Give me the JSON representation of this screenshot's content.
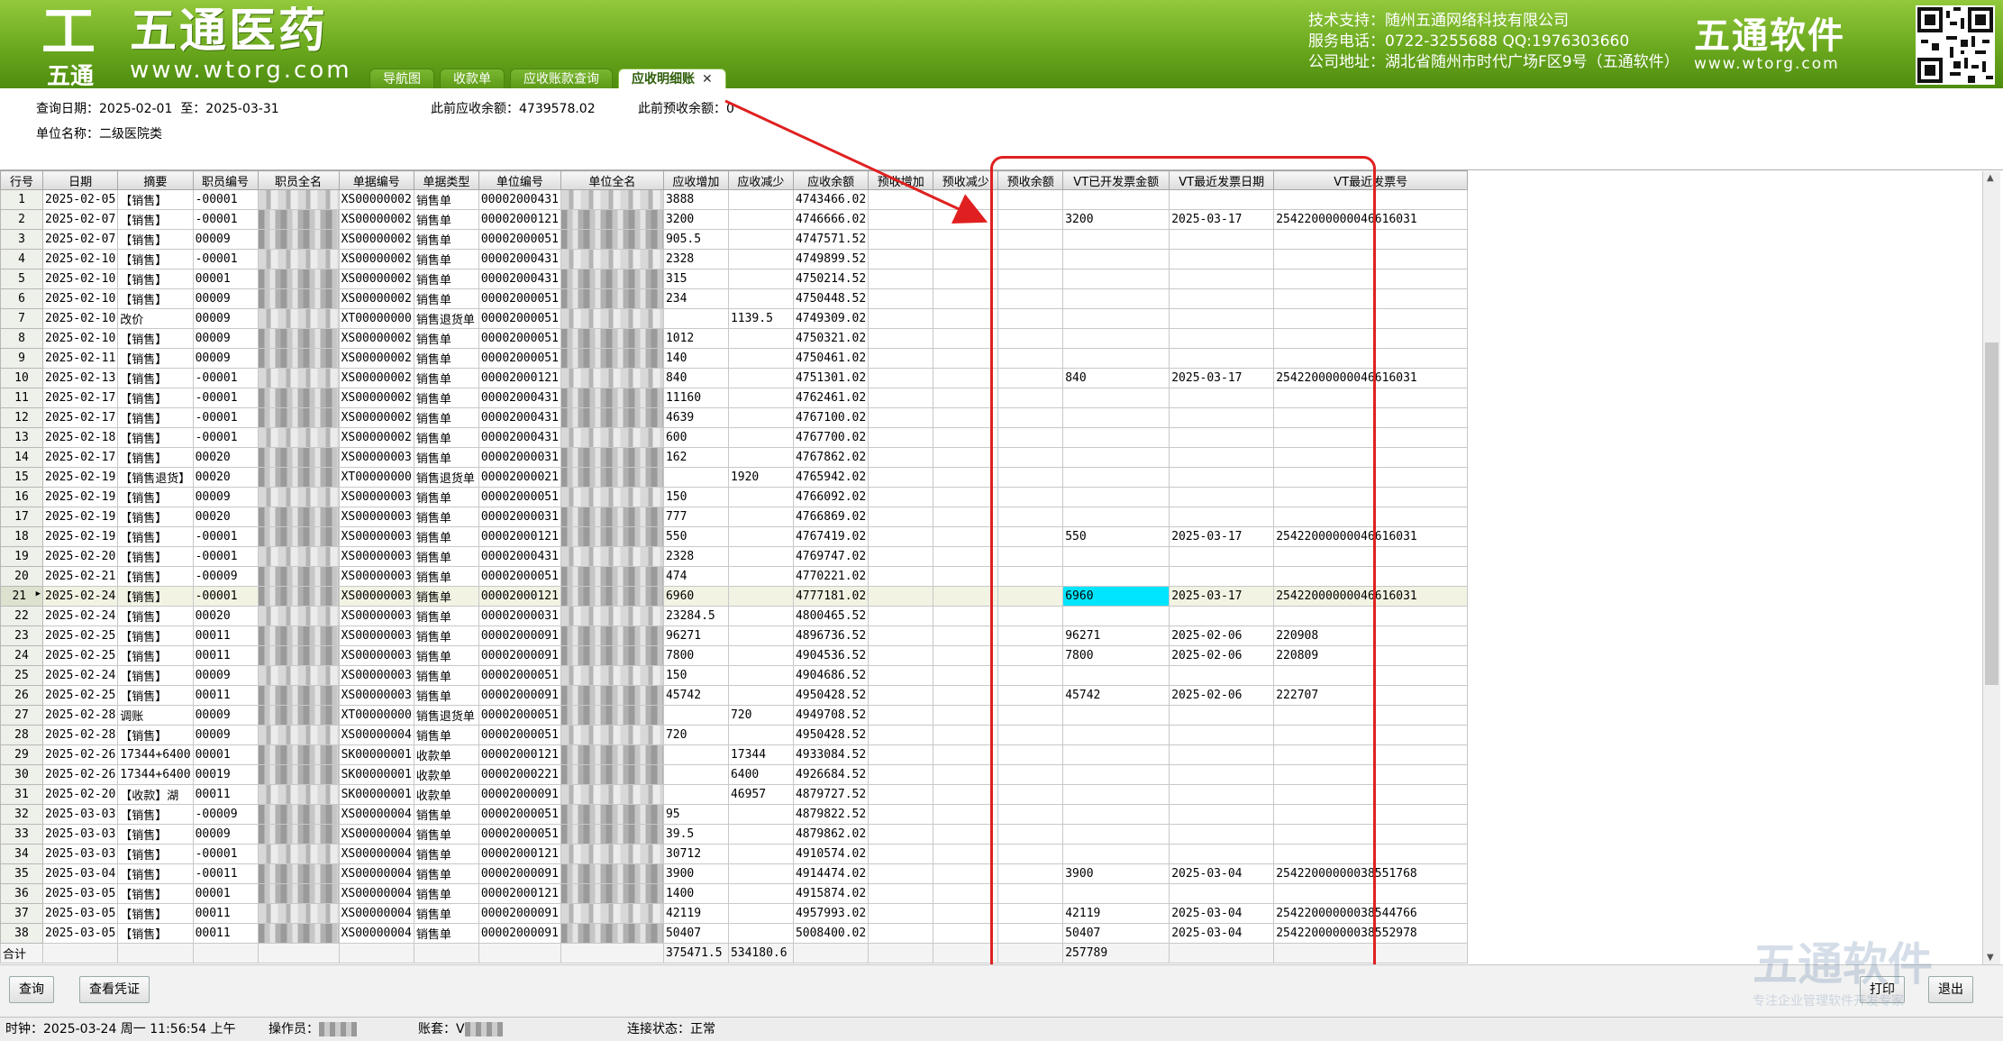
{
  "header": {
    "logo_cn": "五通医药",
    "logo_url": "www.wtorg.com",
    "logo_sub": "五通",
    "support_lines": [
      "技术支持：随州五通网络科技有限公司",
      "服务电话：0722-3255688  QQ:1976303660",
      "公司地址：湖北省随州市时代广场F区9号（五通软件）"
    ],
    "brand_cn": "五通软件",
    "brand_url": "www.wtorg.com",
    "tabs": [
      {
        "label": "导航图",
        "active": false
      },
      {
        "label": "收款单",
        "active": false
      },
      {
        "label": "应收账款查询",
        "active": false
      },
      {
        "label": "应收明细账",
        "active": true
      }
    ],
    "close_glyph": "✕"
  },
  "info": {
    "query_date_label": "查询日期：",
    "date_from": "2025-02-01",
    "date_to_label": "至：",
    "date_to": "2025-03-31",
    "prev_receivable_label": "此前应收余额：",
    "prev_receivable": "4739578.02",
    "prev_prepaid_label": "此前预收余额：",
    "prev_prepaid": "0",
    "unit_name_label": "单位名称：",
    "unit_name": "二级医院类"
  },
  "table": {
    "columns": [
      "行号",
      "日期",
      "摘要",
      "职员编号",
      "职员全名",
      "单据编号",
      "单据类型",
      "单位编号",
      "单位全名",
      "应收增加",
      "应收减少",
      "应收余额",
      "预收增加",
      "预收减少",
      "预收余额",
      "VT已开发票金额",
      "VT最近发票日期",
      "VT最近发票号"
    ],
    "rows": [
      [
        "1",
        "2025-02-05",
        "【销售】",
        "-00001",
        "",
        "XS00000002",
        "销售单",
        "00002000431",
        "",
        "3888",
        "",
        "4743466.02",
        "",
        "",
        "",
        "",
        "",
        ""
      ],
      [
        "2",
        "2025-02-07",
        "【销售】",
        "-00001",
        "",
        "XS00000002",
        "销售单",
        "00002000121",
        "",
        "3200",
        "",
        "4746666.02",
        "",
        "",
        "",
        "3200",
        "2025-03-17",
        "25422000000046616031"
      ],
      [
        "3",
        "2025-02-07",
        "【销售】",
        "00009",
        "",
        "XS00000002",
        "销售单",
        "00002000051",
        "",
        "905.5",
        "",
        "4747571.52",
        "",
        "",
        "",
        "",
        "",
        ""
      ],
      [
        "4",
        "2025-02-10",
        "【销售】",
        "-00001",
        "",
        "XS00000002",
        "销售单",
        "00002000431",
        "",
        "2328",
        "",
        "4749899.52",
        "",
        "",
        "",
        "",
        "",
        ""
      ],
      [
        "5",
        "2025-02-10",
        "【销售】",
        "00001",
        "",
        "XS00000002",
        "销售单",
        "00002000431",
        "",
        "315",
        "",
        "4750214.52",
        "",
        "",
        "",
        "",
        "",
        ""
      ],
      [
        "6",
        "2025-02-10",
        "【销售】",
        "00009",
        "",
        "XS00000002",
        "销售单",
        "00002000051",
        "",
        "234",
        "",
        "4750448.52",
        "",
        "",
        "",
        "",
        "",
        ""
      ],
      [
        "7",
        "2025-02-10",
        "改价",
        "00009",
        "",
        "XT00000000",
        "销售退货单",
        "00002000051",
        "",
        "",
        "1139.5",
        "4749309.02",
        "",
        "",
        "",
        "",
        "",
        ""
      ],
      [
        "8",
        "2025-02-10",
        "【销售】",
        "00009",
        "",
        "XS00000002",
        "销售单",
        "00002000051",
        "",
        "1012",
        "",
        "4750321.02",
        "",
        "",
        "",
        "",
        "",
        ""
      ],
      [
        "9",
        "2025-02-11",
        "【销售】",
        "00009",
        "",
        "XS00000002",
        "销售单",
        "00002000051",
        "",
        "140",
        "",
        "4750461.02",
        "",
        "",
        "",
        "",
        "",
        ""
      ],
      [
        "10",
        "2025-02-13",
        "【销售】",
        "-00001",
        "",
        "XS00000002",
        "销售单",
        "00002000121",
        "",
        "840",
        "",
        "4751301.02",
        "",
        "",
        "",
        "840",
        "2025-03-17",
        "25422000000046616031"
      ],
      [
        "11",
        "2025-02-17",
        "【销售】",
        "-00001",
        "",
        "XS00000002",
        "销售单",
        "00002000431",
        "",
        "11160",
        "",
        "4762461.02",
        "",
        "",
        "",
        "",
        "",
        ""
      ],
      [
        "12",
        "2025-02-17",
        "【销售】",
        "-00001",
        "",
        "XS00000002",
        "销售单",
        "00002000431",
        "",
        "4639",
        "",
        "4767100.02",
        "",
        "",
        "",
        "",
        "",
        ""
      ],
      [
        "13",
        "2025-02-18",
        "【销售】",
        "-00001",
        "",
        "XS00000002",
        "销售单",
        "00002000431",
        "",
        "600",
        "",
        "4767700.02",
        "",
        "",
        "",
        "",
        "",
        ""
      ],
      [
        "14",
        "2025-02-17",
        "【销售】",
        "00020",
        "",
        "XS00000003",
        "销售单",
        "00002000031",
        "",
        "162",
        "",
        "4767862.02",
        "",
        "",
        "",
        "",
        "",
        ""
      ],
      [
        "15",
        "2025-02-19",
        "【销售退货】",
        "00020",
        "",
        "XT00000000",
        "销售退货单",
        "00002000021",
        "",
        "",
        "1920",
        "4765942.02",
        "",
        "",
        "",
        "",
        "",
        ""
      ],
      [
        "16",
        "2025-02-19",
        "【销售】",
        "00009",
        "",
        "XS00000003",
        "销售单",
        "00002000051",
        "",
        "150",
        "",
        "4766092.02",
        "",
        "",
        "",
        "",
        "",
        ""
      ],
      [
        "17",
        "2025-02-19",
        "【销售】",
        "00020",
        "",
        "XS00000003",
        "销售单",
        "00002000031",
        "",
        "777",
        "",
        "4766869.02",
        "",
        "",
        "",
        "",
        "",
        ""
      ],
      [
        "18",
        "2025-02-19",
        "【销售】",
        "-00001",
        "",
        "XS00000003",
        "销售单",
        "00002000121",
        "",
        "550",
        "",
        "4767419.02",
        "",
        "",
        "",
        "550",
        "2025-03-17",
        "25422000000046616031"
      ],
      [
        "19",
        "2025-02-20",
        "【销售】",
        "-00001",
        "",
        "XS00000003",
        "销售单",
        "00002000431",
        "",
        "2328",
        "",
        "4769747.02",
        "",
        "",
        "",
        "",
        "",
        ""
      ],
      [
        "20",
        "2025-02-21",
        "【销售】",
        "-00009",
        "",
        "XS00000003",
        "销售单",
        "00002000051",
        "",
        "474",
        "",
        "4770221.02",
        "",
        "",
        "",
        "",
        "",
        ""
      ],
      [
        "21",
        "2025-02-24",
        "【销售】",
        "-00001",
        "",
        "XS00000003",
        "销售单",
        "00002000121",
        "",
        "6960",
        "",
        "4777181.02",
        "",
        "",
        "",
        "6960",
        "2025-03-17",
        "25422000000046616031"
      ],
      [
        "22",
        "2025-02-24",
        "【销售】",
        "00020",
        "",
        "XS00000003",
        "销售单",
        "00002000031",
        "",
        "23284.5",
        "",
        "4800465.52",
        "",
        "",
        "",
        "",
        "",
        ""
      ],
      [
        "23",
        "2025-02-25",
        "【销售】",
        "00011",
        "",
        "XS00000003",
        "销售单",
        "00002000091",
        "",
        "96271",
        "",
        "4896736.52",
        "",
        "",
        "",
        "96271",
        "2025-02-06",
        "220908"
      ],
      [
        "24",
        "2025-02-25",
        "【销售】",
        "00011",
        "",
        "XS00000003",
        "销售单",
        "00002000091",
        "",
        "7800",
        "",
        "4904536.52",
        "",
        "",
        "",
        "7800",
        "2025-02-06",
        "220809"
      ],
      [
        "25",
        "2025-02-24",
        "【销售】",
        "00009",
        "",
        "XS00000003",
        "销售单",
        "00002000051",
        "",
        "150",
        "",
        "4904686.52",
        "",
        "",
        "",
        "",
        "",
        ""
      ],
      [
        "26",
        "2025-02-25",
        "【销售】",
        "00011",
        "",
        "XS00000003",
        "销售单",
        "00002000091",
        "",
        "45742",
        "",
        "4950428.52",
        "",
        "",
        "",
        "45742",
        "2025-02-06",
        "222707"
      ],
      [
        "27",
        "2025-02-28",
        "调账",
        "00009",
        "",
        "XT00000000",
        "销售退货单",
        "00002000051",
        "",
        "",
        "720",
        "4949708.52",
        "",
        "",
        "",
        "",
        "",
        ""
      ],
      [
        "28",
        "2025-02-28",
        "【销售】",
        "00009",
        "",
        "XS00000004",
        "销售单",
        "00002000051",
        "",
        "720",
        "",
        "4950428.52",
        "",
        "",
        "",
        "",
        "",
        ""
      ],
      [
        "29",
        "2025-02-26",
        "17344+6400",
        "00001",
        "",
        "SK00000001",
        "收款单",
        "00002000121",
        "",
        "",
        "17344",
        "4933084.52",
        "",
        "",
        "",
        "",
        "",
        ""
      ],
      [
        "30",
        "2025-02-26",
        "17344+6400",
        "00019",
        "",
        "SK00000001",
        "收款单",
        "00002000221",
        "",
        "",
        "6400",
        "4926684.52",
        "",
        "",
        "",
        "",
        "",
        ""
      ],
      [
        "31",
        "2025-02-20",
        "【收款】湖",
        "00011",
        "",
        "SK00000001",
        "收款单",
        "00002000091",
        "",
        "",
        "46957",
        "4879727.52",
        "",
        "",
        "",
        "",
        "",
        ""
      ],
      [
        "32",
        "2025-03-03",
        "【销售】",
        "-00009",
        "",
        "XS00000004",
        "销售单",
        "00002000051",
        "",
        "95",
        "",
        "4879822.52",
        "",
        "",
        "",
        "",
        "",
        ""
      ],
      [
        "33",
        "2025-03-03",
        "【销售】",
        "00009",
        "",
        "XS00000004",
        "销售单",
        "00002000051",
        "",
        "39.5",
        "",
        "4879862.02",
        "",
        "",
        "",
        "",
        "",
        ""
      ],
      [
        "34",
        "2025-03-03",
        "【销售】",
        "-00001",
        "",
        "XS00000004",
        "销售单",
        "00002000121",
        "",
        "30712",
        "",
        "4910574.02",
        "",
        "",
        "",
        "",
        "",
        ""
      ],
      [
        "35",
        "2025-03-04",
        "【销售】",
        "-00011",
        "",
        "XS00000004",
        "销售单",
        "00002000091",
        "",
        "3900",
        "",
        "4914474.02",
        "",
        "",
        "",
        "3900",
        "2025-03-04",
        "25422000000038551768"
      ],
      [
        "36",
        "2025-03-05",
        "【销售】",
        "00001",
        "",
        "XS00000004",
        "销售单",
        "00002000121",
        "",
        "1400",
        "",
        "4915874.02",
        "",
        "",
        "",
        "",
        "",
        ""
      ],
      [
        "37",
        "2025-03-05",
        "【销售】",
        "00011",
        "",
        "XS00000004",
        "销售单",
        "00002000091",
        "",
        "42119",
        "",
        "4957993.02",
        "",
        "",
        "",
        "42119",
        "2025-03-04",
        "25422000000038544766"
      ],
      [
        "38",
        "2025-03-05",
        "【销售】",
        "00011",
        "",
        "XS00000004",
        "销售单",
        "00002000091",
        "",
        "50407",
        "",
        "5008400.02",
        "",
        "",
        "",
        "50407",
        "2025-03-04",
        "25422000000038552978"
      ]
    ],
    "selected_row": 21,
    "highlight_cell": {
      "row": 21,
      "col": 15
    },
    "total_row": {
      "label": "合计",
      "recv_increase": "375471.5",
      "recv_decrease": "534180.6",
      "invoice_amount": "257789"
    },
    "row_marker": "▶"
  },
  "buttons": {
    "query": "查询",
    "view_voucher": "查看凭证",
    "print": "打印",
    "exit": "退出"
  },
  "watermark": {
    "cn": "五通软件",
    "sub": "专注企业管理软件开发专家"
  },
  "status": {
    "time_label": "时钟：",
    "time": "2025-03-24 周一 11:56:54 上午",
    "operator_label": "操作员：",
    "account_label": "账套：",
    "account_prefix": "V",
    "connection": "连接状态：正常"
  },
  "colors": {
    "banner_green": "#6aa81e",
    "highlight_cyan": "#00e5ff",
    "annotation_red": "#e02020",
    "selected_row": "#f2f3e3"
  }
}
